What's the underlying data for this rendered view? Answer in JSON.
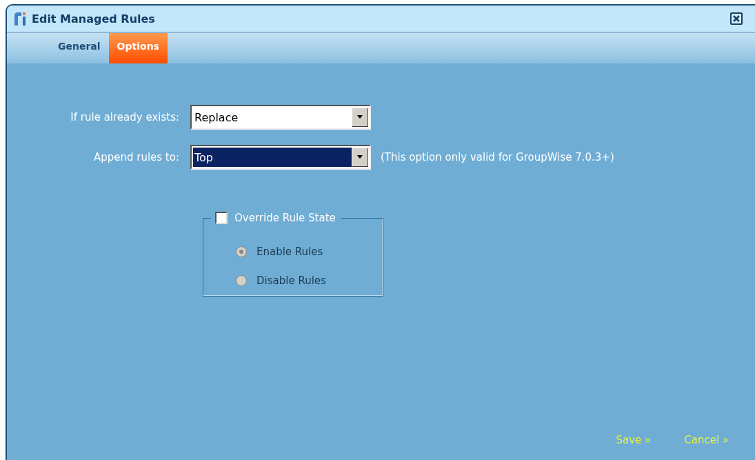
{
  "window": {
    "title": "Edit Managed Rules"
  },
  "tabs": [
    {
      "label": "General",
      "selected": false
    },
    {
      "label": "Options",
      "selected": true
    }
  ],
  "fields": [
    {
      "label": "If rule already exists:",
      "value": "Replace",
      "focused": false
    },
    {
      "label": "Append rules to:",
      "value": "Top",
      "focused": true,
      "note": "(This option only valid for GroupWise 7.0.3+)"
    }
  ],
  "override": {
    "label": "Override Rule State",
    "checked": false,
    "options": [
      {
        "label": "Enable Rules",
        "selected": true,
        "disabled": true
      },
      {
        "label": "Disable Rules",
        "selected": false,
        "disabled": true
      }
    ]
  },
  "buttons": [
    "Save »",
    "Cancel »"
  ]
}
